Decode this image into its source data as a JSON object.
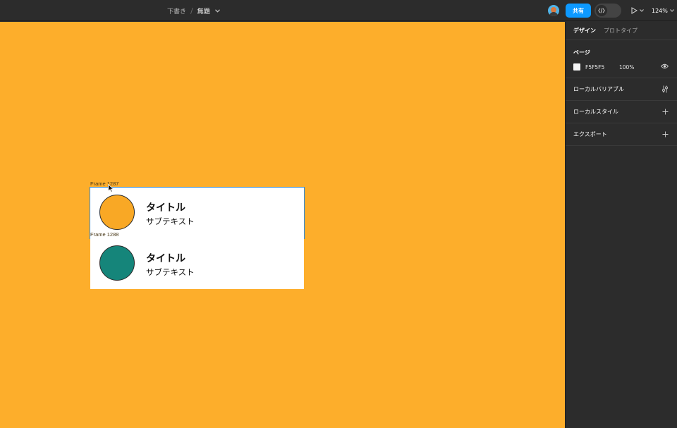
{
  "topbar": {
    "breadcrumb_draft": "下書き",
    "breadcrumb_separator": "/",
    "file_name": "無題",
    "share_label": "共有",
    "zoom_level": "124%"
  },
  "canvas": {
    "background": "#fdae2b",
    "frames": [
      {
        "label": "Frame 1287",
        "title": "タイトル",
        "subtitle": "サブテキスト",
        "circle_color": "#f9a825"
      },
      {
        "label": "Frame 1288",
        "title": "タイトル",
        "subtitle": "サブテキスト",
        "circle_color": "#15857a"
      }
    ]
  },
  "panel": {
    "tabs": [
      {
        "label": "デザイン",
        "active": true
      },
      {
        "label": "プロトタイプ",
        "active": false
      }
    ],
    "page_section": {
      "title": "ページ",
      "color_hex": "F5F5F5",
      "opacity": "100%"
    },
    "local_variables": "ローカルバリアブル",
    "local_styles": "ローカルスタイル",
    "export": "エクスポート"
  },
  "colors": {
    "accent": "#0d99ff",
    "selection": "#2e89d9",
    "panel_bg": "#2c2c2c"
  },
  "icons": [
    "chevron-down-icon",
    "avatar",
    "code-icon",
    "play-icon",
    "eye-icon",
    "variables-icon",
    "plus-icon",
    "cursor-icon"
  ]
}
